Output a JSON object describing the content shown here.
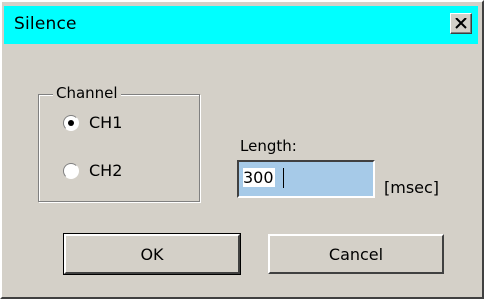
{
  "window": {
    "title": "Silence"
  },
  "icons": {
    "close": "close-icon"
  },
  "channel": {
    "group_label": "Channel",
    "options": [
      {
        "label": "CH1",
        "selected": true
      },
      {
        "label": "CH2",
        "selected": false
      }
    ]
  },
  "length": {
    "label": "Length:",
    "value": "300",
    "unit": "[msec]"
  },
  "buttons": {
    "ok": "OK",
    "cancel": "Cancel"
  },
  "colors": {
    "titlebar": "#00ffff",
    "dialog_bg": "#d4d0c8",
    "input_bg": "#a6cae8"
  }
}
